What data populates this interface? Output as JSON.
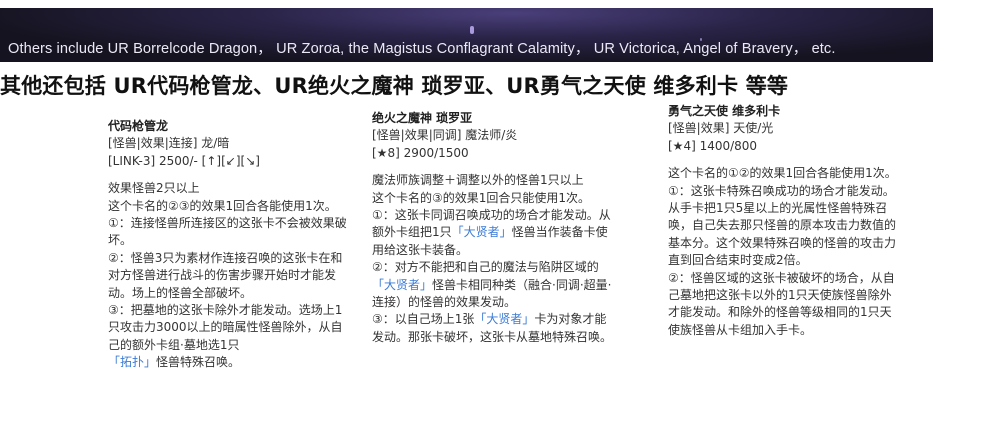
{
  "banner": {
    "text": "Others include UR Borrelcode Dragon， UR Zoroa, the Magistus Conflagrant Calamity， UR Victorica, Angel of Bravery， etc."
  },
  "headline": "其他还包括 UR代码枪管龙、UR绝火之魔神 琐罗亚、UR勇气之天使 维多利卡 等等",
  "cards": [
    {
      "name": "代码枪管龙",
      "type": "[怪兽|效果|连接] 龙/暗",
      "stats": "[LINK-3] 2500/- [↑][↙][↘]",
      "text": [
        "效果怪兽2只以上",
        "这个卡名的②③的效果1回合各能使用1次。",
        "①：连接怪兽所连接区的这张卡不会被效果破坏。",
        "②：怪兽3只为素材作连接召唤的这张卡在和对方怪兽进行战斗的伤害步骤开始时才能发动。场上的怪兽全部破坏。",
        "③：把墓地的这张卡除外才能发动。选场上1只攻击力3000以上的暗属性怪兽除外，从自己的额外卡组·墓地选1只"
      ],
      "link1": "「拓扑」",
      "tail1": "怪兽特殊召唤。"
    },
    {
      "name": "绝火之魔神 琐罗亚",
      "type": "[怪兽|效果|同调] 魔法师/炎",
      "stats": "[★8] 2900/1500",
      "text": [
        "魔法师族调整＋调整以外的怪兽1只以上",
        "这个卡名的③的效果1回合只能使用1次。"
      ],
      "p3a": "①：这张卡同调召唤成功的场合才能发动。从额外卡组把1只",
      "link1": "「大贤者」",
      "p3b": "怪兽当作装备卡使用给这张卡装备。",
      "p4a": "②：对方不能把和自己的魔法与陷阱区域的",
      "link2": "「大贤者」",
      "p4b": "怪兽卡相同种类（融合·同调·超量·连接）的怪兽的效果发动。",
      "p5a": "③：以自己场上1张",
      "link3": "「大贤者」",
      "p5b": "卡为对象才能发动。那张卡破坏，这张卡从墓地特殊召唤。"
    },
    {
      "name": "勇气之天使 维多利卡",
      "type": "[怪兽|效果] 天使/光",
      "stats": "[★4] 1400/800",
      "text": [
        "这个卡名的①②的效果1回合各能使用1次。",
        "①：这张卡特殊召唤成功的场合才能发动。从手卡把1只5星以上的光属性怪兽特殊召唤，自己失去那只怪兽的原本攻击力数值的基本分。这个效果特殊召唤的怪兽的攻击力直到回合结束时变成2倍。",
        "②：怪兽区域的这张卡被破坏的场合，从自己墓地把这张卡以外的1只天使族怪兽除外才能发动。和除外的怪兽等级相同的1只天使族怪兽从卡组加入手卡。"
      ]
    }
  ]
}
